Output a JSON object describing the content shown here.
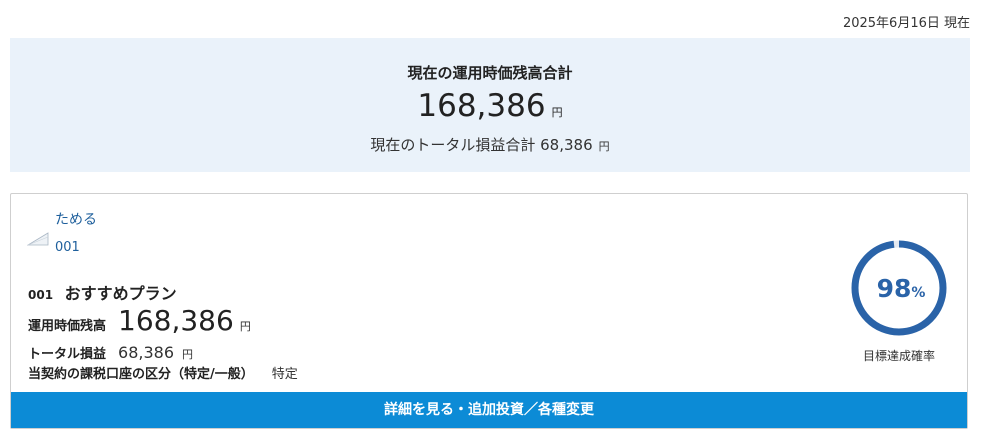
{
  "as_of": "2025年6月16日 現在",
  "summary": {
    "title": "現在の運用時価残高合計",
    "value": "168,386",
    "unit": "円",
    "pl_label": "現在のトータル損益合計",
    "pl_value": "68,386",
    "pl_unit": "円"
  },
  "card": {
    "name": "ためる",
    "code_link": "001",
    "plan_code": "001",
    "plan_name": "おすすめプラン",
    "balance_label": "運用時価残高",
    "balance_value": "168,386",
    "balance_unit": "円",
    "total_pl_label": "トータル損益",
    "total_pl_value": "68,386",
    "total_pl_unit": "円",
    "tax_label": "当契約の課税口座の区分（特定/一般）",
    "tax_value": "特定",
    "gauge_value": "98",
    "gauge_unit": "%",
    "gauge_fraction": 0.98,
    "gauge_label": "目標達成確率",
    "detail_button": "詳細を見る・追加投資／各種変更"
  },
  "colors": {
    "accent": "#0c8bd6",
    "gauge": "#2a63a8",
    "gauge_track": "#e4e9f0",
    "summary_bg": "#eaf2fa",
    "link": "#1e5f9c"
  }
}
